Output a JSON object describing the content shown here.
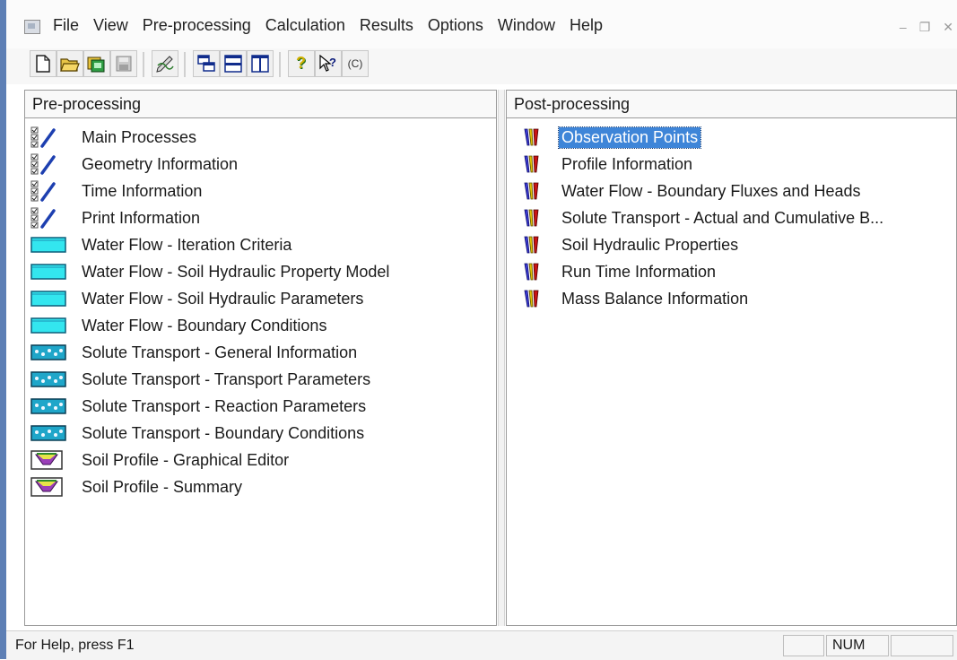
{
  "menu": {
    "items": [
      "File",
      "View",
      "Pre-processing",
      "Calculation",
      "Results",
      "Options",
      "Window",
      "Help"
    ]
  },
  "toolbar": {
    "buttons": [
      "new-document-icon",
      "open-folder-icon",
      "project-manager-icon",
      "save-icon",
      "edit-pencil-icon",
      "cascade-windows-icon",
      "tile-horizontal-icon",
      "tile-vertical-icon",
      "help-icon",
      "context-help-icon",
      "copyright-icon"
    ],
    "copyright_label": "(C)"
  },
  "pre_processing": {
    "header": "Pre-processing",
    "items": [
      {
        "label": "Main Processes",
        "icon": "checklist-pencil-icon"
      },
      {
        "label": "Geometry Information",
        "icon": "checklist-pencil-icon"
      },
      {
        "label": "Time Information",
        "icon": "checklist-pencil-icon"
      },
      {
        "label": "Print Information",
        "icon": "checklist-pencil-icon"
      },
      {
        "label": "Water Flow - Iteration Criteria",
        "icon": "water-flow-icon"
      },
      {
        "label": "Water Flow - Soil Hydraulic Property Model",
        "icon": "water-flow-icon"
      },
      {
        "label": "Water Flow - Soil Hydraulic Parameters",
        "icon": "water-flow-icon"
      },
      {
        "label": "Water Flow - Boundary Conditions",
        "icon": "water-flow-icon"
      },
      {
        "label": "Solute Transport - General Information",
        "icon": "solute-transport-icon"
      },
      {
        "label": "Solute Transport - Transport Parameters",
        "icon": "solute-transport-icon"
      },
      {
        "label": "Solute Transport - Reaction Parameters",
        "icon": "solute-transport-icon"
      },
      {
        "label": "Solute Transport - Boundary Conditions",
        "icon": "solute-transport-icon"
      },
      {
        "label": "Soil Profile - Graphical Editor",
        "icon": "soil-profile-icon"
      },
      {
        "label": "Soil Profile - Summary",
        "icon": "soil-profile-icon"
      }
    ]
  },
  "post_processing": {
    "header": "Post-processing",
    "selected_index": 0,
    "items": [
      {
        "label": "Observation Points",
        "icon": "result-chart-icon"
      },
      {
        "label": "Profile Information",
        "icon": "result-chart-icon"
      },
      {
        "label": "Water Flow - Boundary Fluxes and Heads",
        "icon": "result-chart-icon"
      },
      {
        "label": "Solute Transport - Actual and Cumulative B...",
        "icon": "result-chart-icon"
      },
      {
        "label": "Soil Hydraulic Properties",
        "icon": "result-chart-icon"
      },
      {
        "label": "Run Time Information",
        "icon": "result-chart-icon"
      },
      {
        "label": "Mass Balance Information",
        "icon": "result-chart-icon"
      }
    ]
  },
  "statusbar": {
    "help_text": "For Help, press F1",
    "num_indicator": "NUM"
  },
  "colors": {
    "selection": "#3e85d8",
    "water": "#33e6ef",
    "solute": "#1fa6c9",
    "pencil": "#1d3fb0"
  }
}
